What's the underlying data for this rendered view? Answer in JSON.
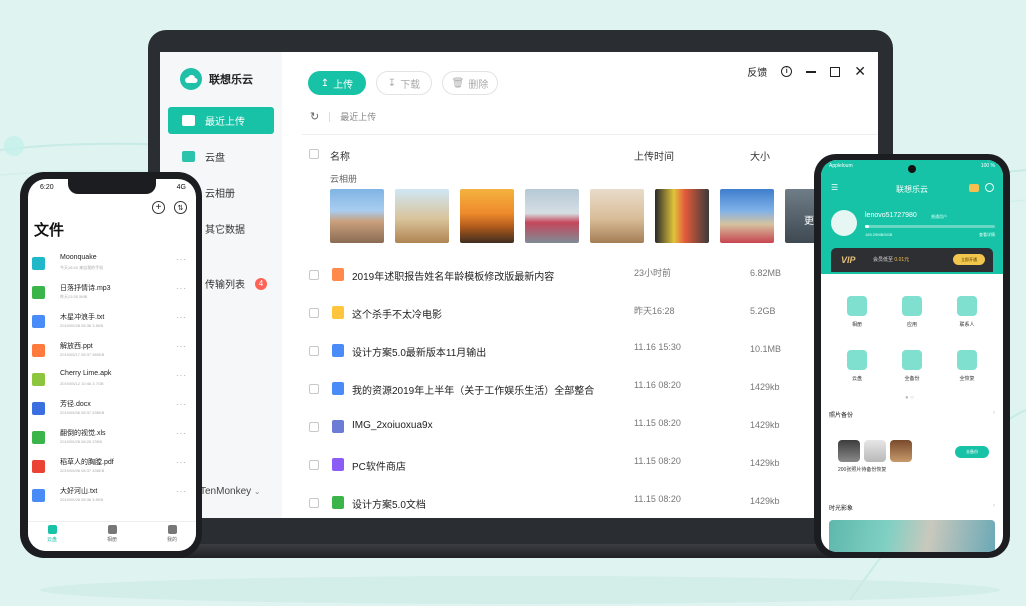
{
  "colors": {
    "accent": "#18c2a6",
    "badge": "#ff6357",
    "vip_gold": "#f6c04f",
    "page_background": "#dff3f1"
  },
  "desktop": {
    "brand": "联想乐云",
    "sidebar": {
      "items": [
        {
          "label": "最近上传",
          "icon": "clock-upload-icon",
          "active": true
        },
        {
          "label": "云盘",
          "icon": "cloud-drive-icon"
        },
        {
          "label": "云相册",
          "icon": "photo-album-icon"
        },
        {
          "label": "其它数据",
          "icon": "other-data-icon"
        },
        {
          "label": "传输列表",
          "icon": "transfer-icon",
          "badge": "4"
        }
      ],
      "user": "TenMonkey"
    },
    "toolbar": {
      "upload": "上传",
      "download": "下载",
      "delete": "删除"
    },
    "window": {
      "feedback": "反馈"
    },
    "breadcrumb": "最近上传",
    "columns": {
      "name": "名称",
      "time": "上传时间",
      "size": "大小"
    },
    "album": {
      "label": "云相册",
      "more": "更"
    },
    "files": [
      {
        "name": "2019年述职报告姓名年龄模板修改版最新内容",
        "time": "23小时前",
        "size": "6.82MB",
        "type": "ppt",
        "color": "#ff8a4c"
      },
      {
        "name": "这个杀手不太冷电影",
        "time": "昨天16:28",
        "size": "5.2GB",
        "type": "folder",
        "color": "#ffc53d"
      },
      {
        "name": "设计方案5.0最新版本11月输出",
        "time": "11.16  15:30",
        "size": "10.1MB",
        "type": "word",
        "color": "#4a8cf7"
      },
      {
        "name": "我的资源2019年上半年（关于工作娱乐生活）全部整合",
        "time": "11.16  08:20",
        "size": "1429kb",
        "type": "doc",
        "color": "#4a8cf7"
      },
      {
        "name": "IMG_2xoiuoxua9x",
        "time": "11.15  08:20",
        "size": "1429kb",
        "type": "image",
        "color": "#6b7bd6"
      },
      {
        "name": "PC软件商店",
        "time": "11.15  08:20",
        "size": "1429kb",
        "type": "app",
        "color": "#8b5cf6"
      },
      {
        "name": "设计方案5.0文档",
        "time": "11.15  08:20",
        "size": "1429kb",
        "type": "sheet",
        "color": "#3bb54a"
      }
    ]
  },
  "phone_left": {
    "time": "6:20",
    "signal": "4G",
    "title": "文件",
    "files": [
      {
        "name": "Moonquake",
        "meta": "今天18:40  来自我的手机",
        "icon": "folder",
        "color": "#20b8c8"
      },
      {
        "name": "日落抒情诗.mp3",
        "meta": "昨天23:35  5MB",
        "icon": "audio",
        "color": "#3bb54a"
      },
      {
        "name": "木星冲浪手.txt",
        "meta": "2019/05/28 08:36  3.8KB",
        "icon": "text",
        "color": "#4a8cf7"
      },
      {
        "name": "解放西.ppt",
        "meta": "2019/05/17 08:37  980KB",
        "icon": "ppt",
        "color": "#ff7a3d"
      },
      {
        "name": "Cherry Lime.apk",
        "meta": "2019/05/12 10:46  3.7GB",
        "icon": "apk",
        "color": "#8cc63f"
      },
      {
        "name": "芳径.docx",
        "meta": "2019/05/06 08:37  536KB",
        "icon": "word",
        "color": "#3b6fe0"
      },
      {
        "name": "翻倒的视觉.xls",
        "meta": "2019/05/28 08:26  23KB",
        "icon": "excel",
        "color": "#3bb54a"
      },
      {
        "name": "稻草人的胸膛.pdf",
        "meta": "2019/05/06 08:37  456KB",
        "icon": "pdf",
        "color": "#ea4335"
      },
      {
        "name": "大好河山.txt",
        "meta": "2019/05/28 08:36  3.8KB",
        "icon": "text",
        "color": "#4a8cf7"
      }
    ],
    "tabs": [
      {
        "label": "云盘",
        "active": true
      },
      {
        "label": "相册"
      },
      {
        "label": "我的"
      }
    ]
  },
  "phone_right": {
    "carrier": "Appleloum",
    "battery": "100 %",
    "title": "联想乐云",
    "username": "lenovo51727980",
    "user_tag": "普通用户",
    "storage_text": "165.29MB/5GB",
    "storage_used_fraction": 0.03,
    "detail": "查看详情",
    "vip": {
      "logo": "VIP",
      "text": "会员低至",
      "price": "0.01元",
      "button": "立即开通"
    },
    "grid": [
      {
        "label": "相册",
        "icon": "album-icon"
      },
      {
        "label": "应用",
        "icon": "app-icon"
      },
      {
        "label": "联系人",
        "icon": "contacts-icon"
      },
      {
        "label": "云盘",
        "icon": "cloud-drive-icon"
      },
      {
        "label": "全备份",
        "icon": "full-backup-icon"
      },
      {
        "label": "全恢复",
        "icon": "full-restore-icon"
      }
    ],
    "photo_backup": {
      "title": "照片备份",
      "text": "200张照片待备份恢复",
      "button": "去备份"
    },
    "moments": {
      "title": "时光影象"
    }
  }
}
